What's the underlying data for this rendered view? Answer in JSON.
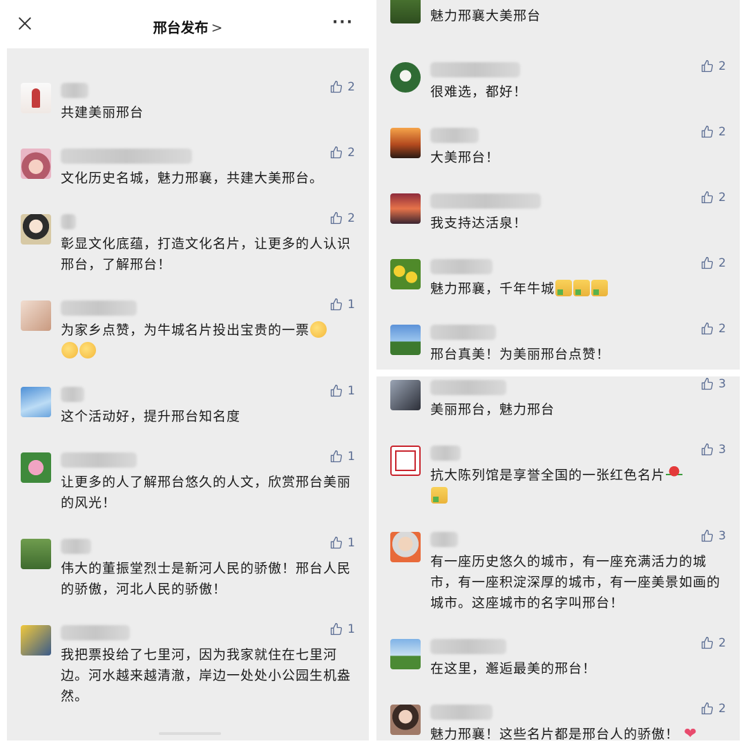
{
  "header": {
    "title": "邢台发布",
    "chevron": ">",
    "more": "···"
  },
  "left": [
    {
      "text": "共建美丽邢台",
      "likes": "2",
      "avatar": "avatar-girl"
    },
    {
      "text": "文化历史名城，魅力邢襄，共建大美邢台。",
      "likes": "2",
      "avatar": "avatar-anime"
    },
    {
      "text": "彰显文化底蕴，打造文化名片，让更多的人认识邢台，了解邢台！",
      "likes": "2",
      "avatar": "avatar-cartoon"
    },
    {
      "text": "为家乡点赞，为牛城名片投出宝贵的一票",
      "likes": "1",
      "avatar": "avatar-photo"
    },
    {
      "text": "这个活动好，提升邢台知名度",
      "likes": "1",
      "avatar": "avatar-sky"
    },
    {
      "text": "让更多的人了解邢台悠久的人文，欣赏邢台美丽的风光！",
      "likes": "1",
      "avatar": "avatar-flower"
    },
    {
      "text": "伟大的董振堂烈士是新河人民的骄傲！邢台人民的骄傲，河北人民的骄傲！",
      "likes": "1",
      "avatar": "avatar-child"
    },
    {
      "text": "我把票投给了七里河，因为我家就住在七里河边。河水越来越清澈，岸边一处处小公园生机盎然。",
      "likes": "1",
      "avatar": "avatar-ginkgo"
    }
  ],
  "right_top": [
    {
      "text": "魅力邢襄大美邢台",
      "likes": "",
      "avatar": "avatar-plant"
    },
    {
      "text": "很难选，都好！",
      "likes": "2",
      "avatar": "avatar-lotus"
    },
    {
      "text": "大美邢台！",
      "likes": "2",
      "avatar": "avatar-sunset"
    },
    {
      "text": "我支持达活泉！",
      "likes": "2",
      "avatar": "avatar-dusk"
    },
    {
      "text": "魅力邢襄，千年牛城",
      "likes": "2",
      "avatar": "avatar-field"
    },
    {
      "text": "邢台真美！为美丽邢台点赞！",
      "likes": "2",
      "avatar": "avatar-tree"
    }
  ],
  "right_bottom": [
    {
      "text": "美丽邢台，魅力邢台",
      "likes": "3",
      "avatar": "avatar-dark"
    },
    {
      "text": "抗大陈列馆是享誉全国的一张红色名片",
      "likes": "3",
      "avatar": "avatar-seal"
    },
    {
      "text": "有一座历史悠久的城市，有一座充满活力的城市，有一座积淀深厚的城市，有一座美景如画的城市。这座城市的名字叫邢台！",
      "likes": "3",
      "avatar": "avatar-baby"
    },
    {
      "text": "在这里，邂逅最美的邢台！",
      "likes": "2",
      "avatar": "avatar-runner"
    },
    {
      "text": "魅力邢襄！这些名片都是邢台人的骄傲！",
      "likes": "2",
      "avatar": "avatar-woman"
    }
  ]
}
